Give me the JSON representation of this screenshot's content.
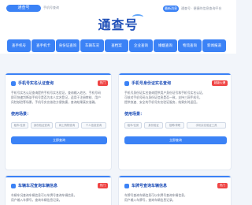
{
  "header": {
    "logo_pill": "通查号",
    "logo_sub": "手机号查询",
    "brand": "通查号",
    "notice_pill": "最新消息",
    "notice_text": "通查号 · 便捷的信息查询平台"
  },
  "nav": {
    "items": [
      {
        "label": "查手机号"
      },
      {
        "label": "查手机卡"
      },
      {
        "label": "身份证查询"
      },
      {
        "label": "车辆车况"
      },
      {
        "label": "查档案"
      },
      {
        "label": "企业查询"
      },
      {
        "label": "婚姻查询"
      },
      {
        "label": "物流查询"
      },
      {
        "label": "新闻报道"
      }
    ]
  },
  "cards": [
    {
      "title": "手机号实名认证查询",
      "badge": "热门",
      "desc_lines": [
        "手机号实名认证查询提供手机号实名验证，查询输入姓名、手机号码",
        "即可快速判断该手机号是否为本人实名登记，适用于注册审核、用户",
        "风险核验等场景，手机号实名核验方便快捷，查询结果真实准确。"
      ],
      "scenes_title": "使用场景：",
      "tags": [
        "租车/住房",
        "身份验证查询",
        "网上购物查询",
        "个人信息查询"
      ],
      "button": "立即查询"
    },
    {
      "title": "手机号身份证实名查询",
      "badge": "超级火爆",
      "desc_lines": [
        "手机号身份证实名查询提供用户身份证号和手机号实名认证，",
        "可核对手机号码与身份证信息是否一致，支持三网手机号，",
        "提供快速、安全的手机号实名验证服务，结果实时返回。"
      ],
      "scenes_title": "使用场景：",
      "tags": [
        "租车/住房",
        "身份验证",
        "招聘/求职",
        "手机实名验证工具"
      ],
      "button": "立即查询"
    },
    {
      "title": "车辆车况查询车辆信息",
      "badge": "热门",
      "desc_lines": [
        "车辆车况查询车辆信息可以车牌号查询车辆信息，",
        "用户输入车牌号，查询车辆信息记录。"
      ]
    },
    {
      "title": "车牌号查询车辆信息",
      "badge": "热门",
      "desc_lines": [
        "车牌号查询车辆信息可以车牌号查询车辆信息，",
        "用户输入车牌号，查询车辆信息记录。"
      ]
    }
  ],
  "colors": {
    "accent": "#3b82f6",
    "brand": "#1f4fb8",
    "badge": "#ef4444"
  }
}
